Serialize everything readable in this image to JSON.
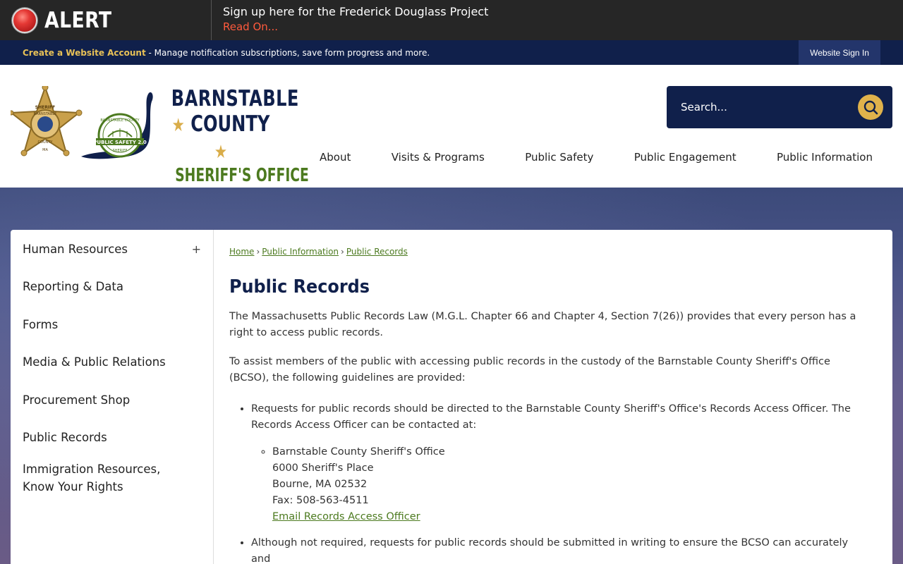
{
  "alert": {
    "label": "ALERT",
    "title": "Sign up here for the Frederick Douglass Project",
    "link": "Read On..."
  },
  "account": {
    "create_label": "Create a Website Account",
    "description": " - Manage notification subscriptions, save form progress and more.",
    "signin_label": "Website Sign In"
  },
  "logo": {
    "line1": "BARNSTABLE",
    "line2": "COUNTY",
    "line3": "SHERIFF'S OFFICE",
    "badge_lines": [
      "SHERIFF",
      "BARNSTABLE",
      "COUNTY",
      "MA"
    ],
    "seal_lines": [
      "BARNSTABLE COUNTY",
      "PUBLIC SAFETY 2.0",
      "SHERIFF"
    ]
  },
  "search": {
    "placeholder": "Search..."
  },
  "nav": [
    {
      "label": "About"
    },
    {
      "label": "Visits & Programs"
    },
    {
      "label": "Public Safety"
    },
    {
      "label": "Public Engagement"
    },
    {
      "label": "Public Information"
    }
  ],
  "sidebar": {
    "items": [
      {
        "label": "Human Resources",
        "toggle": "+"
      },
      {
        "label": "Reporting & Data"
      },
      {
        "label": "Forms"
      },
      {
        "label": "Media & Public Relations"
      },
      {
        "label": "Procurement Shop"
      },
      {
        "label": "Public Records"
      },
      {
        "label": "Immigration Resources,",
        "label2": "Know Your Rights"
      }
    ]
  },
  "breadcrumb": {
    "items": [
      "Home",
      "Public Information",
      "Public Records"
    ],
    "separator": "›"
  },
  "page": {
    "title": "Public Records",
    "para1": "The Massachusetts Public Records Law (M.G.L. Chapter 66 and Chapter 4, Section 7(26)) provides that every person has a right to access public records.",
    "para2": "To assist members of the public with accessing public records in the custody of the Barnstable County Sheriff's Office (BCSO), the following guidelines are provided:",
    "bullet1": "Requests for public records should be directed to the Barnstable County Sheriff's Office's Records Access Officer. The Records Access Officer can be contacted at:",
    "contact": {
      "name": "Barnstable County Sheriff's Office",
      "street": "6000 Sheriff's Place",
      "city": "Bourne, MA 02532",
      "fax": "Fax: 508-563-4511",
      "email_link": "Email Records Access Officer"
    },
    "bullet2": "Although not required, requests for public records should be submitted in writing to ensure the BCSO can accurately and"
  },
  "colors": {
    "navy": "#10204b",
    "gold": "#e0b24b",
    "green": "#4c7a1f",
    "alert_red": "#ff5a3c"
  }
}
